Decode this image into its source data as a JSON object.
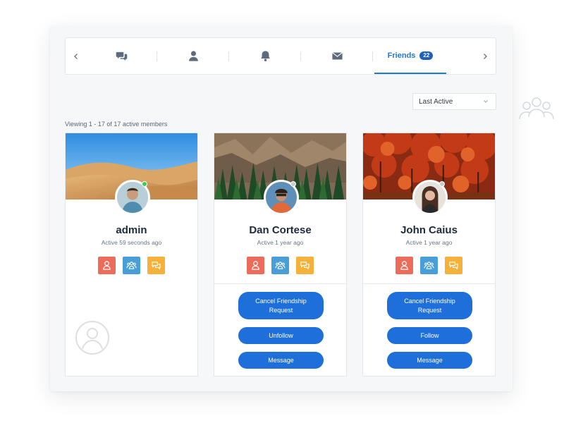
{
  "tabs": [
    {
      "name": "messages",
      "icon": "chat-bubbles-icon"
    },
    {
      "name": "profile",
      "icon": "user-icon"
    },
    {
      "name": "notifications",
      "icon": "bell-icon"
    },
    {
      "name": "email",
      "icon": "envelope-icon"
    },
    {
      "name": "friends",
      "label": "Friends",
      "badge": "22",
      "active": true
    }
  ],
  "sort": {
    "selected": "Last Active"
  },
  "viewing_text": "Viewing 1 - 17 of 17 active members",
  "members": [
    {
      "name": "admin",
      "active": "Active 59 seconds ago",
      "status_color": "#3bc95a"
    },
    {
      "name": "Dan Cortese",
      "active": "Active 1 year ago",
      "status_color": "#c8ccd1",
      "buttons": {
        "friendship": "Cancel Friendship Request",
        "follow": "Unfollow",
        "message": "Message"
      }
    },
    {
      "name": "John Caius",
      "active": "Active 1 year ago",
      "status_color": "#c8ccd1",
      "buttons": {
        "friendship": "Cancel Friendship Request",
        "follow": "Follow",
        "message": "Message"
      }
    }
  ],
  "colors": {
    "accent": "#1e6fd9",
    "red": "#ec6b5b",
    "blue": "#4a9ed8",
    "yellow": "#f6b13a"
  }
}
